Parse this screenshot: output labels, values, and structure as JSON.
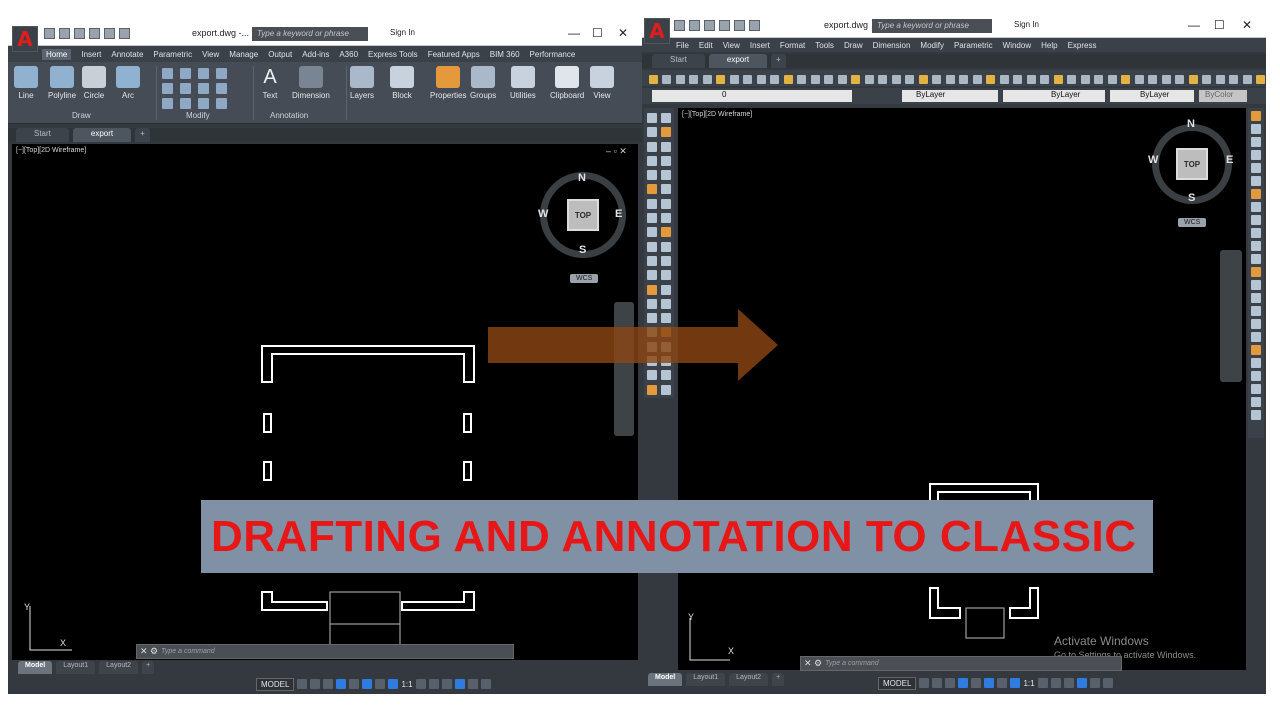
{
  "banner": {
    "text": "DRAFTING AND ANNOTATION TO CLASSIC",
    "text_color": "#e81717",
    "bg_color": "#8191a5"
  },
  "arrow": {
    "color": "#8b4513",
    "direction": "right"
  },
  "left_window": {
    "title": "export.dwg -...",
    "search_placeholder": "Type a keyword or phrase",
    "sign_in": "Sign In",
    "ribbon_tabs": [
      "Home",
      "Insert",
      "Annotate",
      "Parametric",
      "View",
      "Manage",
      "Output",
      "Add-ins",
      "A360",
      "Express Tools",
      "Featured Apps",
      "BIM 360",
      "Performance"
    ],
    "active_tab": "Home",
    "draw_tools": [
      "Line",
      "Polyline",
      "Circle",
      "Arc"
    ],
    "annotation_tools": [
      "Text",
      "Dimension"
    ],
    "big_tools": [
      "Layers",
      "Block",
      "Properties",
      "Groups",
      "Utilities",
      "Clipboard",
      "View"
    ],
    "panels": {
      "draw": "Draw",
      "modify": "Modify",
      "annotation": "Annotation"
    },
    "file_tabs": [
      "Start",
      "export"
    ],
    "viewport_label": "[−][Top][2D Wireframe]",
    "compass": {
      "n": "N",
      "s": "S",
      "e": "E",
      "w": "W",
      "face": "TOP",
      "wcs": "WCS"
    },
    "ucs": {
      "x": "X",
      "y": "Y"
    },
    "command_placeholder": "Type a command",
    "layout_tabs": [
      "Model",
      "Layout1",
      "Layout2"
    ],
    "status": {
      "model": "MODEL",
      "scale": "1:1"
    }
  },
  "right_window": {
    "title": "export.dwg",
    "search_placeholder": "Type a keyword or phrase",
    "sign_in": "Sign In",
    "menu": [
      "File",
      "Edit",
      "View",
      "Insert",
      "Format",
      "Tools",
      "Draw",
      "Dimension",
      "Modify",
      "Parametric",
      "Window",
      "Help",
      "Express"
    ],
    "file_tabs": [
      "Start",
      "export"
    ],
    "layer_value": "0",
    "properties": [
      "ByLayer",
      "ByLayer",
      "ByLayer",
      "ByColor"
    ],
    "viewport_label": "[−][Top][2D Wireframe]",
    "compass": {
      "n": "N",
      "s": "S",
      "e": "E",
      "w": "W",
      "face": "TOP",
      "wcs": "WCS"
    },
    "ucs": {
      "x": "X",
      "y": "Y"
    },
    "command_placeholder": "Type a command",
    "layout_tabs": [
      "Model",
      "Layout1",
      "Layout2"
    ],
    "status": {
      "model": "MODEL",
      "scale": "1:1"
    },
    "watermark": {
      "title": "Activate Windows",
      "subtitle": "Go to Settings to activate Windows."
    }
  }
}
